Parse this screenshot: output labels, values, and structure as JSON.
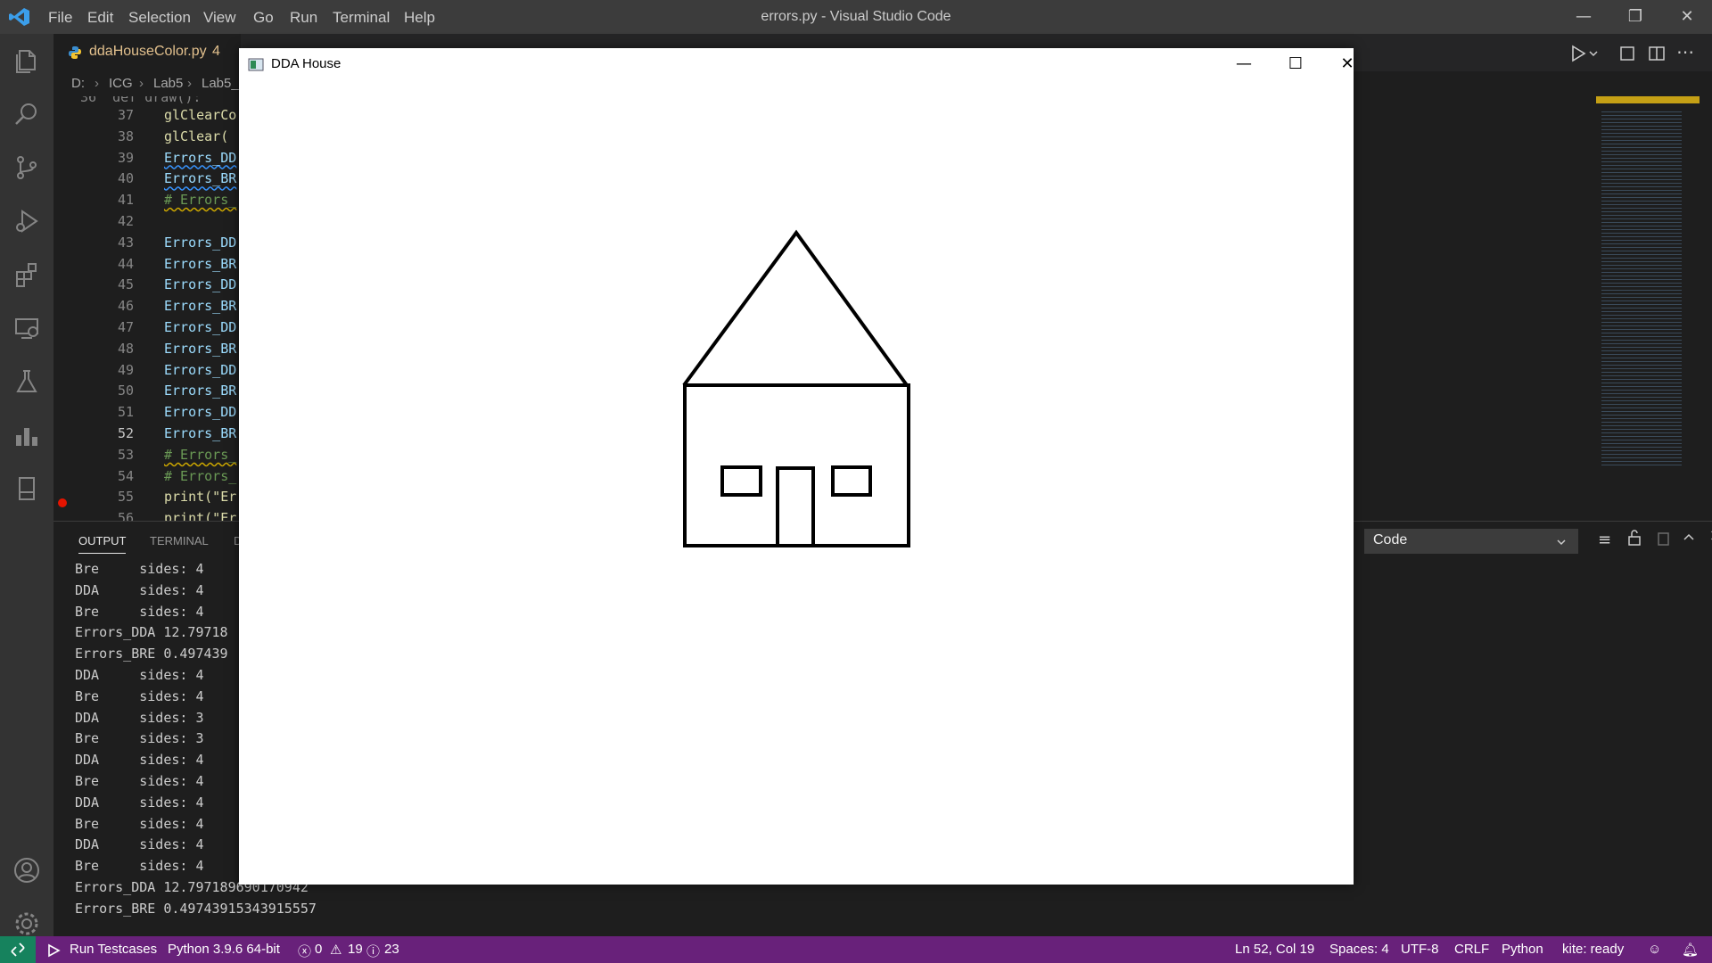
{
  "titlebar": {
    "menus": [
      "File",
      "Edit",
      "Selection",
      "View",
      "Go",
      "Run",
      "Terminal",
      "Help"
    ],
    "title": "errors.py - Visual Studio Code"
  },
  "tab": {
    "label": "ddaHouseColor.py",
    "badge": "4"
  },
  "breadcrumb": [
    "D:",
    "ICG",
    "Lab5",
    "Lab5_Cl"
  ],
  "editor": {
    "top_partial": "36  def draw():",
    "lines": [
      {
        "n": "37",
        "code": "glClearCo",
        "cls": "fn"
      },
      {
        "n": "38",
        "code": "glClear(",
        "cls": "fn"
      },
      {
        "n": "39",
        "code": "Errors_DD",
        "cls": "squig"
      },
      {
        "n": "40",
        "code": "Errors_BR",
        "cls": "squig"
      },
      {
        "n": "41",
        "code": "# Errors_",
        "cls": "comment squig-y"
      },
      {
        "n": "42",
        "code": "",
        "cls": ""
      },
      {
        "n": "43",
        "code": "Errors_DD",
        "cls": ""
      },
      {
        "n": "44",
        "code": "Errors_BR",
        "cls": ""
      },
      {
        "n": "45",
        "code": "Errors_DD",
        "cls": ""
      },
      {
        "n": "46",
        "code": "Errors_BR",
        "cls": ""
      },
      {
        "n": "47",
        "code": "Errors_DD",
        "cls": ""
      },
      {
        "n": "48",
        "code": "Errors_BR",
        "cls": ""
      },
      {
        "n": "49",
        "code": "Errors_DD",
        "cls": ""
      },
      {
        "n": "50",
        "code": "Errors_BR",
        "cls": ""
      },
      {
        "n": "51",
        "code": "Errors_DD",
        "cls": ""
      },
      {
        "n": "52",
        "code": "Errors_BR",
        "cls": "",
        "current": true
      },
      {
        "n": "53",
        "code": "# Errors_",
        "cls": "comment squig-y"
      },
      {
        "n": "54",
        "code": "# Errors_",
        "cls": "comment"
      },
      {
        "n": "55",
        "code": "print(\"Er",
        "cls": "fn"
      },
      {
        "n": "56",
        "code": "print(\"Er",
        "cls": "fn"
      }
    ]
  },
  "panel": {
    "tabs": [
      "OUTPUT",
      "TERMINAL",
      "D"
    ],
    "select_value": "Code",
    "output": [
      "Bre     sides: 4",
      "DDA     sides: 4",
      "Bre     sides: 4",
      "Errors_DDA 12.79718",
      "Errors_BRE 0.497439",
      "DDA     sides: 4",
      "Bre     sides: 4",
      "DDA     sides: 3",
      "Bre     sides: 3",
      "DDA     sides: 4",
      "Bre     sides: 4",
      "DDA     sides: 4",
      "Bre     sides: 4",
      "DDA     sides: 4",
      "Bre     sides: 4",
      "Errors_DDA 12.797189690170942",
      "Errors_BRE 0.49743915343915557"
    ]
  },
  "popup": {
    "title": "DDA House"
  },
  "status": {
    "run": "Run Testcases",
    "python": "Python 3.9.6 64-bit",
    "errors": "0",
    "warnings": "19",
    "infos": "23",
    "position": "Ln 52, Col 19",
    "spaces": "Spaces: 4",
    "encoding": "UTF-8",
    "eol": "CRLF",
    "language": "Python",
    "kite": "kite: ready"
  },
  "colors": {
    "titlebar": "#3c3c3c",
    "activitybar": "#333333",
    "editor": "#1e1e1e",
    "statusbar": "#68217a",
    "remote": "#16825d",
    "tab_modified": "#e2c08d"
  }
}
